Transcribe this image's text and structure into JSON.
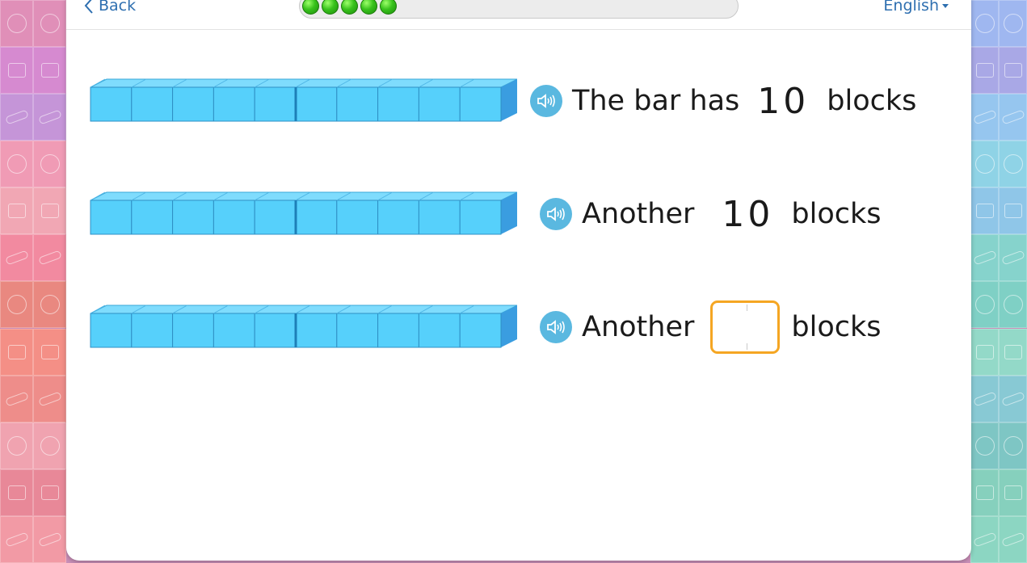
{
  "colors": {
    "bar_face": "#56d0fb",
    "bar_top": "#7fdcfd",
    "bar_side": "#3a9de0",
    "accent": "#2e6fb0",
    "answer_border": "#f5a623"
  },
  "header": {
    "back_label": "Back",
    "language": "English",
    "progress_filled": 5
  },
  "rows": [
    {
      "text_before": "The bar has",
      "number": "10",
      "text_after": "blocks",
      "blocks": 10
    },
    {
      "text_before": "Another",
      "number": "10",
      "text_after": "blocks",
      "blocks": 10
    },
    {
      "text_before": "Another",
      "number": "",
      "text_after": "blocks",
      "blocks": 10
    }
  ],
  "icons": [
    "chevron-left-icon",
    "speaker-icon",
    "caret-down-icon"
  ]
}
